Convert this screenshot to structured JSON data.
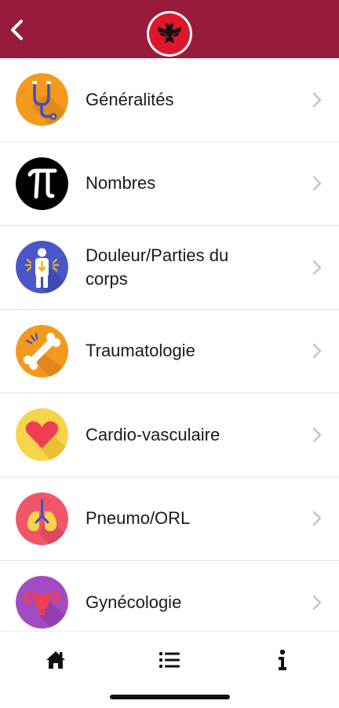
{
  "header": {
    "background": "#991b3b",
    "back_icon": "chevron-left-icon",
    "logo_icon": "albanian-eagle-flag-icon"
  },
  "categories": [
    {
      "label": "Généralités",
      "icon": "stethoscope-icon",
      "color": "#f39a1e"
    },
    {
      "label": "Nombres",
      "icon": "pi-icon",
      "color": "#000000"
    },
    {
      "label": "Douleur/Parties du corps",
      "icon": "body-pain-icon",
      "color": "#4a57c8"
    },
    {
      "label": "Traumatologie",
      "icon": "broken-bone-icon",
      "color": "#f39a1e"
    },
    {
      "label": "Cardio-vasculaire",
      "icon": "heart-icon",
      "color": "#f7d54a"
    },
    {
      "label": "Pneumo/ORL",
      "icon": "lungs-icon",
      "color": "#f0566a"
    },
    {
      "label": "Gynécologie",
      "icon": "uterus-icon",
      "color": "#a24cc3"
    }
  ],
  "tabbar": {
    "items": [
      {
        "name": "home",
        "icon": "home-icon"
      },
      {
        "name": "list",
        "icon": "list-icon"
      },
      {
        "name": "info",
        "icon": "info-icon"
      }
    ]
  }
}
